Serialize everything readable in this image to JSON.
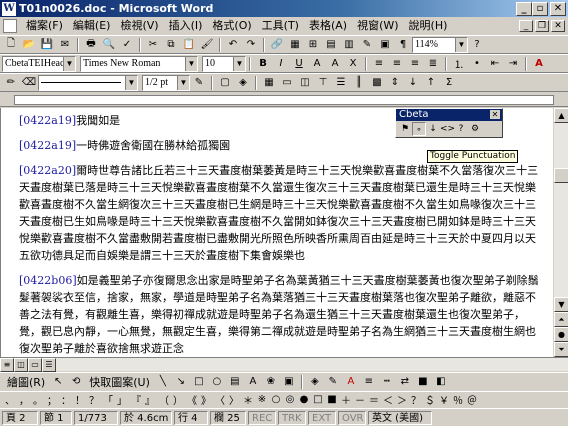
{
  "window": {
    "title": "T01n0026.doc - Microsoft Word"
  },
  "menu": [
    "檔案(F)",
    "編輯(E)",
    "檢視(V)",
    "插入(I)",
    "格式(O)",
    "工具(T)",
    "表格(A)",
    "視窗(W)",
    "說明(H)"
  ],
  "toolbar_standard": {
    "zoom": "114%"
  },
  "toolbar_formatting": {
    "style": "CbetaTEIHeac",
    "font": "Times New Roman",
    "size": "10"
  },
  "toolbar_drawing2": {
    "line_spacing": "1/2 pt"
  },
  "document": {
    "paragraphs": [
      {
        "ref": "[0422a19]",
        "text": "我聞如是"
      },
      {
        "ref": "[0422a19]",
        "text": "一時佛遊舍衛國在勝林給孤獨園"
      },
      {
        "ref": "[0422a20]",
        "text": "爾時世尊告諸比丘若三十三天晝度樹葉萎黃是時三十三天悅樂歡喜晝度樹葉不久當落復次三十三天晝度樹葉已落是時三十三天悅樂歡喜晝度樹葉不久當還生復次三十三天晝度樹葉已還生是時三十三天悅樂歡喜晝度樹不久當生網復次三十三天晝度樹已生網是時三十三天悅樂歡喜晝度樹不久當生如鳥喙復次三十三天晝度樹已生如鳥喙是時三十三天悅樂歡喜晝度樹不久當開如鉢復次三十三天晝度樹已開如鉢是時三十三天悅樂歡喜晝度樹不久當盡敷開若晝度樹已盡敷開光所照色所映香所熏周百由延是時三十三天於中夏四月以天五欲功德具足而自娛樂是謂三十三天於晝度樹下集會娛樂也"
      },
      {
        "ref": "[0422b06]",
        "text": "如是義聖弟子亦復爾思念出家是時聖弟子名為葉黃猶三十三天晝度樹葉萎黃也復次聖弟子剃除鬚髮著袈裟衣至信，捨家，無家，學道是時聖弟子名為葉落猶三十三天晝度樹葉落也復次聖弟子離欲，離惡不善之法有覺，有觀離生喜，樂得初禪成就遊是時聖弟子名為還生猶三十三天晝度樹葉還生也復次聖弟子，覺，觀已息內靜，一心無覺，無觀定生喜，樂得第二禪成就遊是時聖弟子名為生網猶三十三天晝度樹生網也復次聖弟子離於喜欲捨無求遊正念"
      }
    ]
  },
  "cbeta_toolbar": {
    "title": "Cbeta",
    "tooltip": "Toggle Punctuation"
  },
  "draw_toolbar": {
    "draw_label": "繪圖(R)",
    "autoshapes_label": "快取圖案(U)"
  },
  "symbols": [
    "、",
    "，",
    "。",
    "；",
    "：",
    "！",
    "？",
    "「",
    "」",
    "『",
    "』",
    "（",
    "）",
    "《",
    "》",
    "〈",
    "〉",
    "＊",
    "※",
    "○",
    "◎",
    "●",
    "□",
    "■",
    "＋",
    "－",
    "＝",
    "＜",
    "＞",
    "？",
    "＄",
    "￥",
    "％",
    "＠"
  ],
  "status": {
    "page": "頁 2",
    "section": "節 1",
    "pages": "1/773",
    "at": "於 4.6cm",
    "line": "行 4",
    "col": "欄 25",
    "rec": "REC",
    "trk": "TRK",
    "ext": "EXT",
    "ovr": "OVR",
    "lang": "英文 (美國)"
  }
}
